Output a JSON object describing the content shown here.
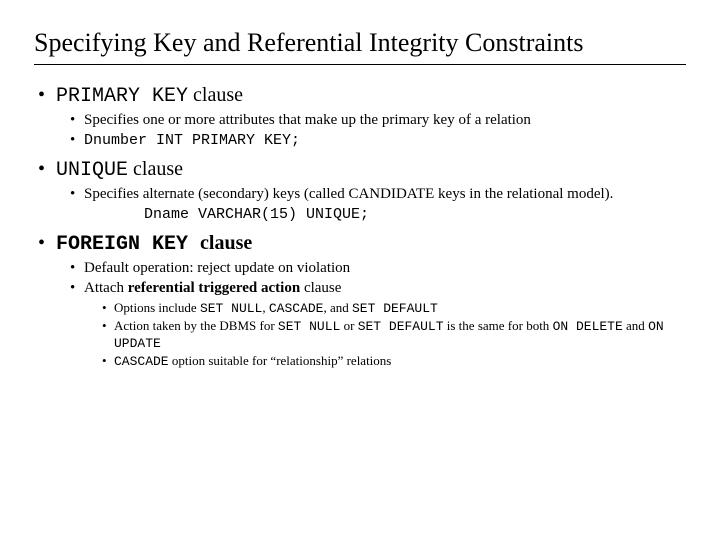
{
  "title": "Specifying Key and Referential Integrity Constraints",
  "b1": {
    "code": "PRIMARY KEY",
    "suffix": " clause",
    "sub1": "Specifies one or more attributes that make up the primary key of a relation",
    "sub2": "Dnumber INT PRIMARY KEY;"
  },
  "b2": {
    "code": "UNIQUE",
    "suffix": " clause",
    "sub1": "Specifies alternate (secondary) keys (called CANDIDATE keys in the relational model).",
    "example": "Dname VARCHAR(15) UNIQUE;"
  },
  "b3": {
    "code": "FOREIGN KEY ",
    "suffix": "clause",
    "sub1": "Default operation: reject update on violation",
    "sub2_pre": "Attach ",
    "sub2_bold": "referential triggered action",
    "sub2_post": " clause",
    "o1_pre": "Options include ",
    "o1_c1": "SET NULL",
    "o1_s1": ", ",
    "o1_c2": "CASCADE",
    "o1_s2": ", and ",
    "o1_c3": "SET DEFAULT",
    "o2_pre": "Action taken by the DBMS for ",
    "o2_c1": "SET NULL",
    "o2_mid": " or ",
    "o2_c2": "SET DEFAULT",
    "o2_mid2": " is the same for both ",
    "o2_c3": "ON DELETE",
    "o2_mid3": " and ",
    "o2_c4": "ON UPDATE",
    "o3_c": "CASCADE",
    "o3_post": " option suitable for “relationship” relations"
  }
}
